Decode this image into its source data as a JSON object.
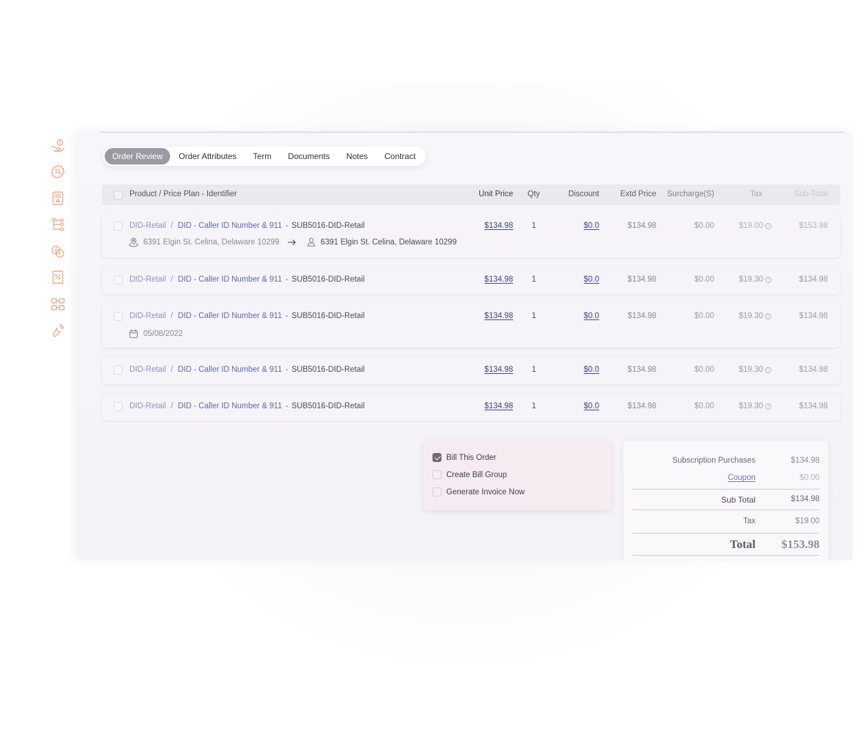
{
  "tabs": [
    "Order Review",
    "Order Attributes",
    "Term",
    "Documents",
    "Notes",
    "Contract"
  ],
  "active_tab": "Order Review",
  "rail_icons": [
    "hand-coin-icon",
    "percent-badge-icon",
    "receipt-icon",
    "hierarchy-icon",
    "coins-icon",
    "invoice-percent-icon",
    "flow-icon",
    "wrench-icon"
  ],
  "table": {
    "headers": {
      "product": "Product / Price Plan - Identifier",
      "unit_price": "Unit Price",
      "qty": "Qty",
      "discount": "Discount",
      "extd_price": "Extd Price",
      "surcharge": "Surcharge(S)",
      "tax": "Tax",
      "subtotal": "Sub-Total"
    },
    "rows": [
      {
        "product": "DID-Retail",
        "plan": "DID - Caller ID Number & 911",
        "identifier": "SUB5016-DID-Retail",
        "unit_price": "$134.98",
        "qty": "1",
        "discount": "$0.0",
        "extd_price": "$134.98",
        "surcharge": "$0.00",
        "tax": "$19.00",
        "subtotal": "$153.98",
        "from_address": "6391 Elgin St. Celina, Delaware 10299",
        "to_address": "6391 Elgin St. Celina, Delaware 10299"
      },
      {
        "product": "DID-Retail",
        "plan": "DID - Caller ID Number & 911",
        "identifier": "SUB5016-DID-Retail",
        "unit_price": "$134.98",
        "qty": "1",
        "discount": "$0.0",
        "extd_price": "$134.98",
        "surcharge": "$0.00",
        "tax": "$19.30",
        "subtotal": "$134.98"
      },
      {
        "product": "DID-Retail",
        "plan": "DID - Caller ID Number & 911",
        "identifier": "SUB5016-DID-Retail",
        "unit_price": "$134.98",
        "qty": "1",
        "discount": "$0.0",
        "extd_price": "$134.98",
        "surcharge": "$0.00",
        "tax": "$19.30",
        "subtotal": "$134.98",
        "date": "05/08/2022"
      },
      {
        "product": "DID-Retail",
        "plan": "DID - Caller ID Number & 911",
        "identifier": "SUB5016-DID-Retail",
        "unit_price": "$134.98",
        "qty": "1",
        "discount": "$0.0",
        "extd_price": "$134.98",
        "surcharge": "$0.00",
        "tax": "$19.30",
        "subtotal": "$134.98"
      },
      {
        "product": "DID-Retail",
        "plan": "DID - Caller ID Number & 911",
        "identifier": "SUB5016-DID-Retail",
        "unit_price": "$134.98",
        "qty": "1",
        "discount": "$0.0",
        "extd_price": "$134.98",
        "surcharge": "$0.00",
        "tax": "$19.30",
        "subtotal": "$134.98"
      }
    ]
  },
  "options": [
    {
      "label": "Bill This Order",
      "checked": true
    },
    {
      "label": "Create Bill Group",
      "checked": false
    },
    {
      "label": "Generate Invoice Now",
      "checked": false
    }
  ],
  "totals": {
    "subscription_label": "Subscription Purchases",
    "subscription_value": "$134.98",
    "coupon_label": "Coupon",
    "coupon_value": "$0.00",
    "subtotal_label": "Sub Total",
    "subtotal_value": "$134.98",
    "tax_label": "Tax",
    "tax_value": "$19.00",
    "total_label": "Total",
    "total_value": "$153.98"
  },
  "colors": {
    "accent_icon": "#ea9c7b",
    "link": "#3d3f8c",
    "breadcrumb": "#5e68b0",
    "active_tab": "#9b9aa4"
  }
}
